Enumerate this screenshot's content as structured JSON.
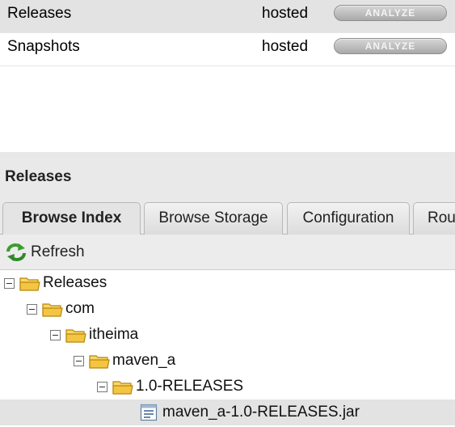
{
  "repositories": [
    {
      "name": "Releases",
      "type": "hosted",
      "action": "ANALYZE"
    },
    {
      "name": "Snapshots",
      "type": "hosted",
      "action": "ANALYZE"
    }
  ],
  "panel": {
    "title": "Releases",
    "tabs": [
      {
        "label": "Browse Index",
        "active": true
      },
      {
        "label": "Browse Storage",
        "active": false
      },
      {
        "label": "Configuration",
        "active": false
      },
      {
        "label": "Rou",
        "active": false
      }
    ],
    "toolbar": {
      "refresh_label": "Refresh",
      "refresh_icon": "refresh-icon"
    }
  },
  "tree": {
    "nodes": [
      {
        "label": "Releases",
        "icon": "folder-icon",
        "expanded": true
      },
      {
        "label": "com",
        "icon": "folder-icon",
        "expanded": true
      },
      {
        "label": "itheima",
        "icon": "folder-icon",
        "expanded": true
      },
      {
        "label": "maven_a",
        "icon": "folder-icon",
        "expanded": true
      },
      {
        "label": "1.0-RELEASES",
        "icon": "folder-icon",
        "expanded": true
      },
      {
        "label": "maven_a-1.0-RELEASES.jar",
        "icon": "file-icon",
        "selected": true
      }
    ]
  },
  "colors": {
    "folder_fill": "#f4c542",
    "folder_stroke": "#b8860b",
    "refresh_green": "#3a9d2f",
    "row_highlight": "#e3e3e3"
  }
}
